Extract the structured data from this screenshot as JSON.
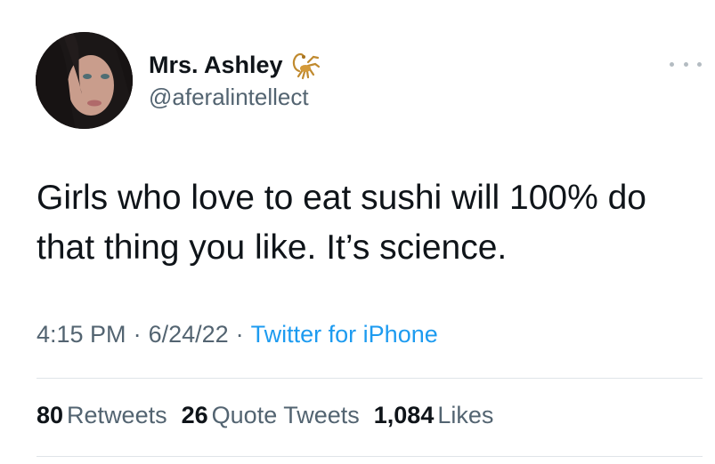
{
  "author": {
    "display_name": "Mrs. Ashley",
    "handle": "@aferalintellect",
    "name_emoji_icon": "scorpion-icon"
  },
  "tweet": {
    "text": "Girls who love to eat sushi will 100% do that thing you like. It’s science.",
    "time": "4:15 PM",
    "date": "6/24/22",
    "separator": "·",
    "source": "Twitter for iPhone"
  },
  "stats": [
    {
      "count": "80",
      "label": "Retweets"
    },
    {
      "count": "26",
      "label": "Quote Tweets"
    },
    {
      "count": "1,084",
      "label": "Likes"
    }
  ],
  "colors": {
    "text_primary": "#0f1419",
    "text_secondary": "#536471",
    "link": "#1d9bf0",
    "divider": "#dfe4e8"
  }
}
